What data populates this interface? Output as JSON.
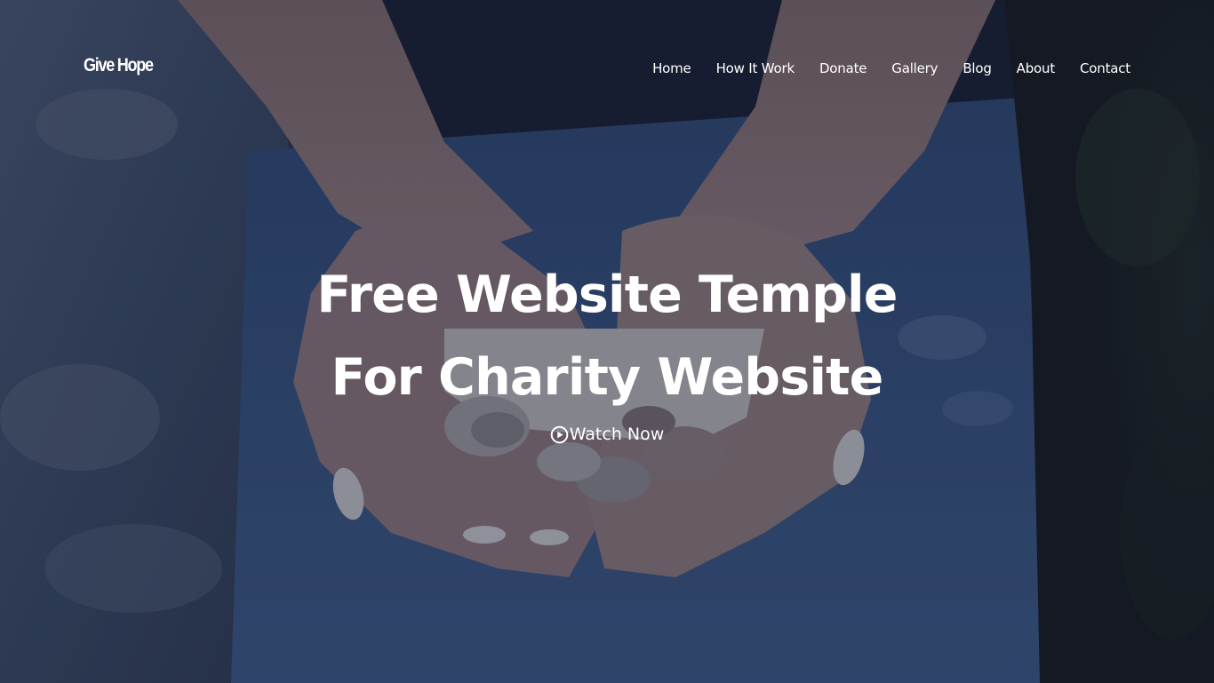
{
  "brand": {
    "name": "Give Hope"
  },
  "nav": {
    "items": [
      {
        "label": "Home"
      },
      {
        "label": "How It Work"
      },
      {
        "label": "Donate"
      },
      {
        "label": "Gallery"
      },
      {
        "label": "Blog"
      },
      {
        "label": "About"
      },
      {
        "label": "Contact"
      }
    ]
  },
  "hero": {
    "title_line_1": "Free Website Temple",
    "title_line_2": "For Charity Website",
    "cta_icon": "play-circle-icon",
    "cta_label": "Watch Now",
    "background_image": "hands-holding-coins-photo"
  },
  "colors": {
    "text": "#ffffff",
    "overlay": "#1c2233",
    "denim": "#3f5f8f"
  }
}
